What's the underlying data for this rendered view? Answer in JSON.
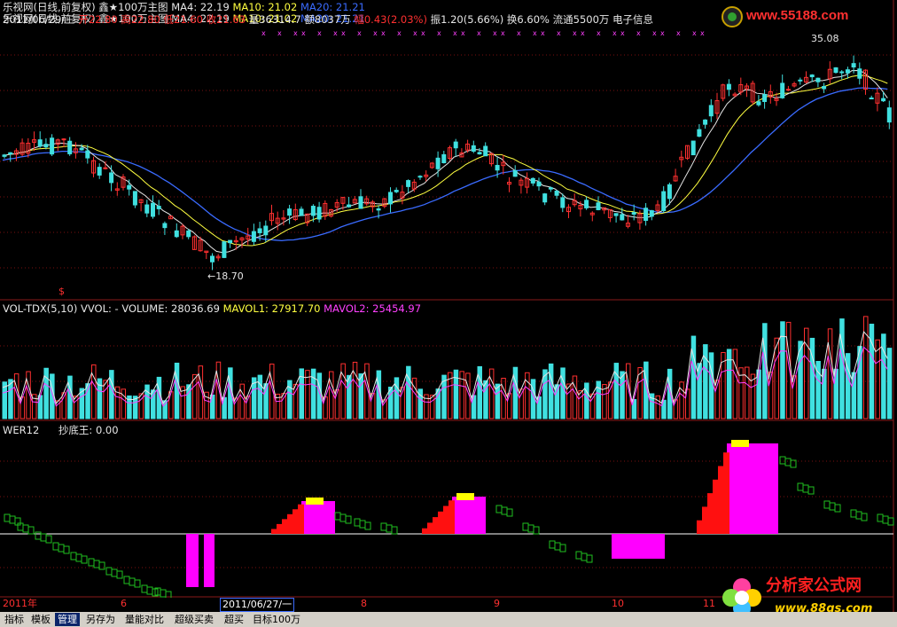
{
  "header": {
    "line1": {
      "title": "乐视网(日线,前复权)",
      "indicator": "鑫★100万主图",
      "ma4": "MA4: 22.19",
      "ma10": "MA10: 21.02",
      "ma20": "MA20: 21.21"
    },
    "line2": {
      "date": "2011/06/29/三",
      "open": "开22.80",
      "high": "高22.80",
      "low": "低21.60",
      "close": "收21.63",
      "volume": "量36314.7",
      "amount": "额8037万",
      "change": "幅0.43(2.03%)",
      "amplitude": "振1.20(5.66%)",
      "turnover": "换6.60%",
      "float": "流通5500万",
      "news": "电子信息"
    }
  },
  "main_chart": {
    "high_label": "35.08",
    "low_label": "←18.70",
    "dollar_marker": "$"
  },
  "volume_panel": {
    "name": "VOL-TDX(5,10)",
    "vvol": "VVOL: -",
    "volume": "VOLUME: 28036.69",
    "mavol1": "MAVOL1: 27917.70",
    "mavol2": "MAVOL2: 25454.97"
  },
  "wer_panel": {
    "name": "WER12",
    "value": "抄底王: 0.00"
  },
  "date_axis": {
    "ticks": [
      "2011年",
      "6",
      "2011/06/27/一",
      "8",
      "9",
      "10",
      "11"
    ]
  },
  "bottom_tabs": [
    "指标",
    "模板",
    "管理",
    "另存为",
    "量能对比",
    "超级买卖",
    "超买",
    "目标100万"
  ],
  "logo_top": {
    "text": "www.55188.com"
  },
  "logo_bottom": {
    "text": "分析家公式网",
    "url": "www.88gs.com"
  },
  "colors": {
    "up": "#ff3030",
    "down": "#40e0e0",
    "ma4": "#e6e6e6",
    "ma10": "#ffff40",
    "ma20": "#3a6bff",
    "mavol2": "#ff40ff",
    "wer_fill": "#ff00ff",
    "wer_red": "#ff1010",
    "wer_yellow": "#ffff00",
    "wer_green": "#20c020"
  }
}
